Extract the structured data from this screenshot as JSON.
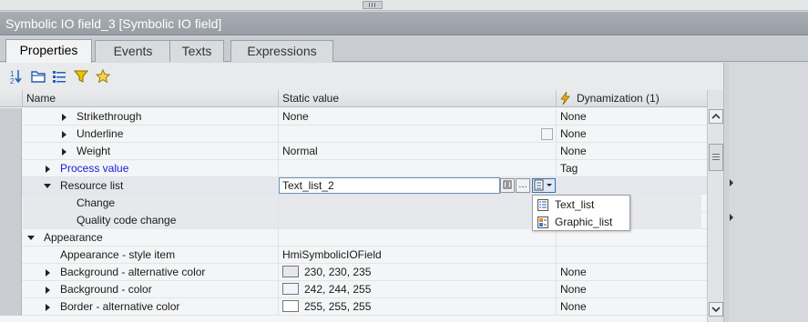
{
  "window": {
    "title": "Symbolic IO field_3 [Symbolic IO field]"
  },
  "tabs": [
    {
      "label": "Properties"
    },
    {
      "label": "Events"
    },
    {
      "label": "Texts"
    },
    {
      "label": "Expressions"
    }
  ],
  "toolbar": {
    "icons": [
      "sort-az-icon",
      "folder-icon",
      "list-icon",
      "filter-icon",
      "favorite-star-icon"
    ]
  },
  "grid": {
    "headers": {
      "name": "Name",
      "static_value": "Static value",
      "dynamization": "Dynamization (1)"
    },
    "rows": [
      {
        "name": "Strikethrough",
        "value": "None",
        "dyn": "None"
      },
      {
        "name": "Underline",
        "value": "",
        "dyn": "None"
      },
      {
        "name": "Weight",
        "value": "Normal",
        "dyn": "None"
      },
      {
        "name": "Process value",
        "value": "",
        "dyn": "Tag"
      },
      {
        "name": "Resource list",
        "value": "Text_list_2",
        "dyn": ""
      },
      {
        "name": "Change",
        "value": "",
        "dyn": ""
      },
      {
        "name": "Quality code change",
        "value": "",
        "dyn": ""
      },
      {
        "name": "Appearance",
        "value": "",
        "dyn": ""
      },
      {
        "name": "Appearance - style item",
        "value": "HmiSymbolicIOField",
        "dyn": ""
      },
      {
        "name": "Background - alternative color",
        "value": "230, 230, 235",
        "dyn": "None",
        "color": "#e6e6eb"
      },
      {
        "name": "Background - color",
        "value": "242, 244, 255",
        "dyn": "None",
        "color": "#f2f4ff"
      },
      {
        "name": "Border - alternative color",
        "value": "255, 255, 255",
        "dyn": "None",
        "color": "#ffffff"
      }
    ]
  },
  "dropdown": {
    "items": [
      {
        "label": "Text_list",
        "icon": "text-list-icon"
      },
      {
        "label": "Graphic_list",
        "icon": "graphic-list-icon"
      }
    ]
  },
  "colors": {
    "link_blue": "#1a1adc",
    "edit_border": "#6f8fb5"
  }
}
